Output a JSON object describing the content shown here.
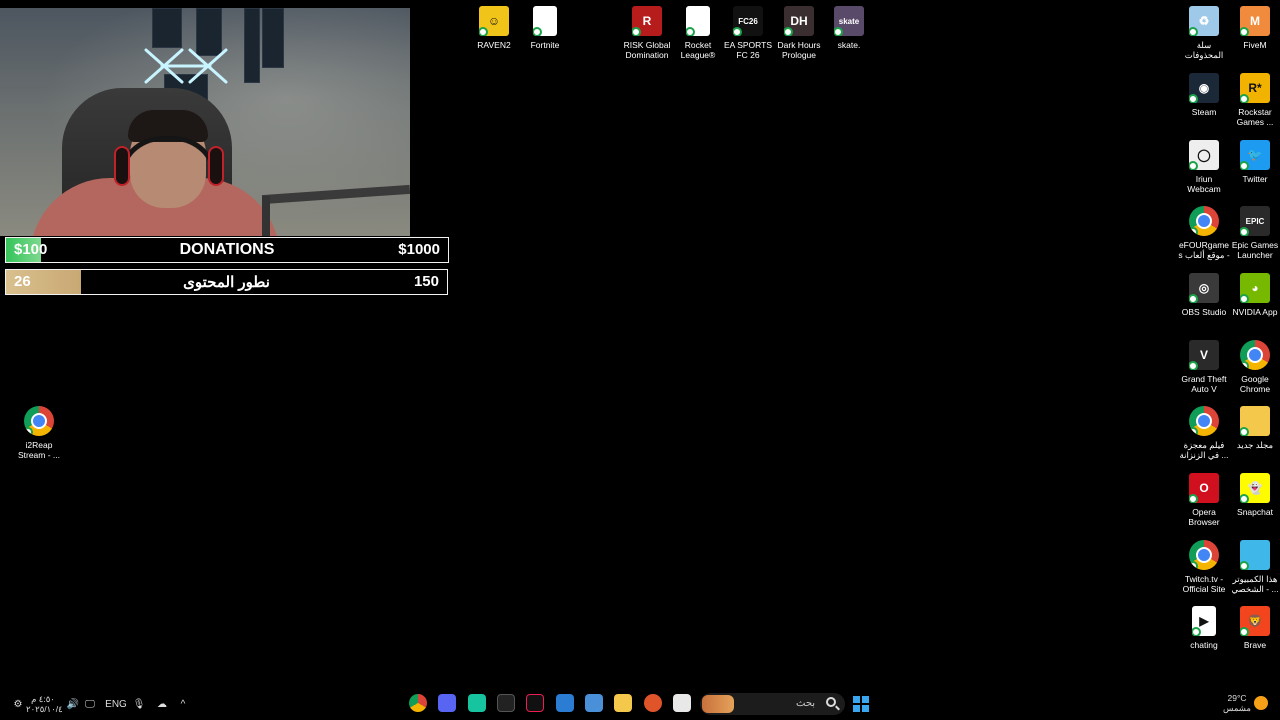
{
  "overlay": {
    "donations": {
      "left": "$100",
      "title": "DONATIONS",
      "right": "$1000",
      "progress": 0.08
    },
    "goal": {
      "left": "26",
      "title": "نطور المحتوى",
      "right": "150",
      "progress": 0.17
    }
  },
  "desktop_icons": [
    {
      "name": "raven2",
      "label": "RAVEN2",
      "color": "#f0c419",
      "glyph": "☺"
    },
    {
      "name": "fortnite",
      "label": "Fortnite",
      "color": "#ffffff",
      "glyph": ""
    },
    {
      "name": "risk",
      "label": "RISK Global Domination",
      "color": "#b71c1c",
      "glyph": "R"
    },
    {
      "name": "rocket-league",
      "label": "Rocket League®",
      "color": "#ffffff",
      "glyph": ""
    },
    {
      "name": "fc26",
      "label": "EA SPORTS FC 26",
      "color": "#111111",
      "glyph": "FC26"
    },
    {
      "name": "dark-hours",
      "label": "Dark Hours Prologue",
      "color": "#3a2e30",
      "glyph": "DH"
    },
    {
      "name": "skate",
      "label": "skate.",
      "color": "#5a4a6a",
      "glyph": "skate"
    },
    {
      "name": "recycle-bin",
      "label": "سلة المحذوفات",
      "color": "#9ec9e8",
      "glyph": "♻"
    },
    {
      "name": "fivem",
      "label": "FiveM",
      "color": "#f08a3c",
      "glyph": "M"
    },
    {
      "name": "steam",
      "label": "Steam",
      "color": "#1b2838",
      "glyph": "◉"
    },
    {
      "name": "rockstar",
      "label": "Rockstar Games ...",
      "color": "#f2b300",
      "glyph": "R*"
    },
    {
      "name": "iriun",
      "label": "Iriun Webcam",
      "color": "#eeeeee",
      "glyph": "◯"
    },
    {
      "name": "twitter",
      "label": "Twitter",
      "color": "#1d9bf0",
      "glyph": "🐦"
    },
    {
      "name": "efour",
      "label": "eFOURgames موقع ألعاب -",
      "color": "chrome",
      "glyph": ""
    },
    {
      "name": "epic",
      "label": "Epic Games Launcher",
      "color": "#2a2a2a",
      "glyph": "EPIC"
    },
    {
      "name": "obs",
      "label": "OBS Studio",
      "color": "#3a3a3a",
      "glyph": "◎"
    },
    {
      "name": "nvidia",
      "label": "NVIDIA App",
      "color": "#76b900",
      "glyph": "◕"
    },
    {
      "name": "gta",
      "label": "Grand Theft Auto V",
      "color": "#2a2a2a",
      "glyph": "V"
    },
    {
      "name": "chrome",
      "label": "Google Chrome",
      "color": "chrome",
      "glyph": ""
    },
    {
      "name": "film",
      "label": "فيلم معجزة في الزنزانة ...",
      "color": "chrome",
      "glyph": ""
    },
    {
      "name": "new-folder",
      "label": "مجلد جديد",
      "color": "#f4c84a",
      "glyph": ""
    },
    {
      "name": "opera",
      "label": "Opera Browser",
      "color": "#d0101f",
      "glyph": "O"
    },
    {
      "name": "snapchat",
      "label": "Snapchat",
      "color": "#fffc00",
      "glyph": "👻"
    },
    {
      "name": "twitch",
      "label": "Twitch.tv - Official Site",
      "color": "chrome",
      "glyph": ""
    },
    {
      "name": "this-pc",
      "label": "هذا الكمبيوتر الشخصي - ...",
      "color": "#3fb7e8",
      "glyph": ""
    },
    {
      "name": "chating",
      "label": "chating",
      "color": "#ffffff",
      "glyph": "▶"
    },
    {
      "name": "brave",
      "label": "Brave",
      "color": "#f2441d",
      "glyph": "🦁"
    },
    {
      "name": "i2reap",
      "label": "i2Reap Stream - ...",
      "color": "chrome",
      "glyph": ""
    }
  ],
  "taskbar": {
    "search_label": "بحث",
    "weather_temp": "29°C",
    "weather_desc": "مشمس",
    "clock_time": "٤:٥٠ م",
    "clock_date": "٢٠٢٥/١٠/٤",
    "language": "ENG"
  }
}
